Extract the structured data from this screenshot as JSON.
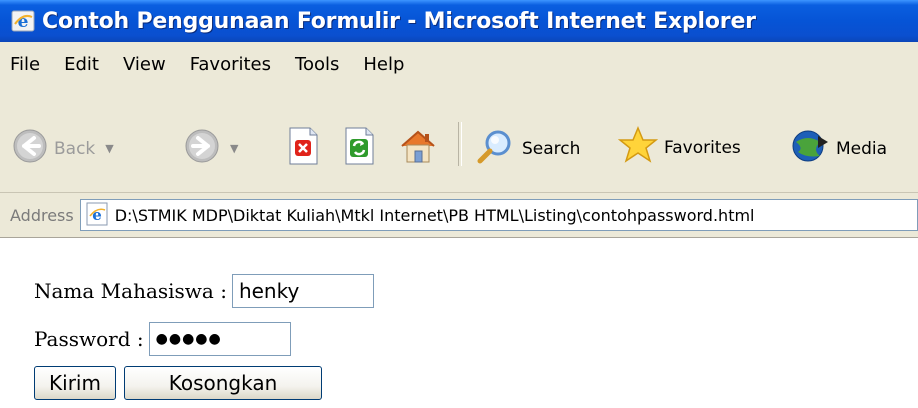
{
  "window": {
    "title": "Contoh Penggunaan Formulir - Microsoft Internet Explorer"
  },
  "menu": {
    "items": [
      "File",
      "Edit",
      "View",
      "Favorites",
      "Tools",
      "Help"
    ]
  },
  "toolbar": {
    "back_label": "Back",
    "search_label": "Search",
    "favorites_label": "Favorites",
    "media_label": "Media",
    "icons": [
      "back-arrow-icon",
      "forward-arrow-icon",
      "stop-icon",
      "refresh-icon",
      "home-icon",
      "search-icon",
      "favorites-star-icon",
      "media-icon"
    ]
  },
  "address": {
    "label": "Address",
    "url": "D:\\STMIK MDP\\Diktat Kuliah\\Mtkl Internet\\PB HTML\\Listing\\contohpassword.html"
  },
  "form": {
    "name_label": "Nama Mahasiswa :",
    "name_value": "henky",
    "password_label": "Password :",
    "password_value": "●●●●●",
    "submit_label": "Kirim",
    "reset_label": "Kosongkan"
  },
  "colors": {
    "titlebar": "#0654d6",
    "chrome": "#ece9d8",
    "input_border": "#7f9db9",
    "button_border": "#003c74"
  }
}
